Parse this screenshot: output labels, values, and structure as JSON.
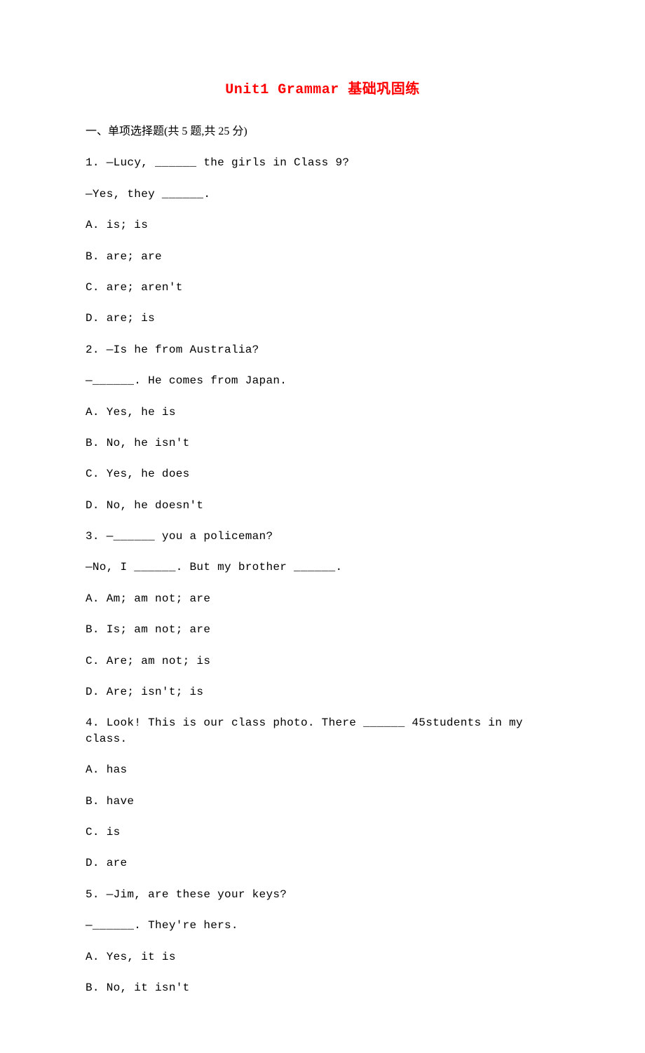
{
  "title": "Unit1 Grammar 基础巩固练",
  "section_header": "一、单项选择题(共 5 题,共 25 分)",
  "questions": [
    {
      "num": "1.",
      "lines": [
        "—Lucy, ______ the girls in Class 9?",
        "—Yes, they ______."
      ],
      "options": [
        "A. is; is",
        "B. are; are",
        "C. are; aren't",
        "D. are; is"
      ]
    },
    {
      "num": "2.",
      "lines": [
        "—Is he from Australia?",
        "—______. He comes from Japan."
      ],
      "options": [
        "A. Yes, he is",
        "B. No, he isn't",
        "C. Yes, he does",
        "D. No, he doesn't"
      ]
    },
    {
      "num": "3.",
      "lines": [
        "—______ you a policeman?",
        "—No, I ______. But my brother ______."
      ],
      "options": [
        "A. Am; am not; are",
        "B. Is; am not; are",
        "C. Are; am not; is",
        "D. Are; isn't; is"
      ]
    },
    {
      "num": "4.",
      "lines": [
        "Look! This is our class photo. There ______ 45students in my class."
      ],
      "options": [
        "A. has",
        "B. have",
        "C. is",
        "D. are"
      ]
    },
    {
      "num": "5.",
      "lines": [
        "—Jim, are these your keys?",
        "—______. They're hers."
      ],
      "options": [
        "A. Yes, it is",
        "B. No, it isn't"
      ]
    }
  ]
}
